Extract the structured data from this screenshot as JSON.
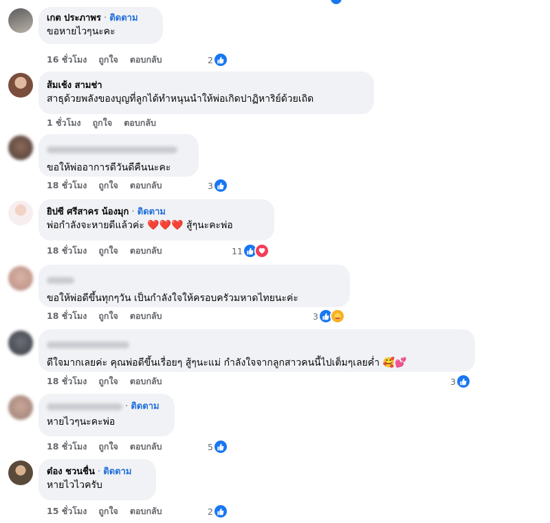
{
  "comments": [
    {
      "name": "เกต ประภาพร",
      "follow": "ติดตาม",
      "text": "ขอหายไวๆนะคะ",
      "time": "16 ชั่วโมง",
      "like": "ถูกใจ",
      "reply": "ตอบกลับ",
      "reaction_count": "2",
      "reactions": [
        "like"
      ]
    },
    {
      "name": "ส้มเช้ง สามช่า",
      "text": "สาธุด้วยพลังของบุญที่ลูกได้ทำหนุนนำให้พ่อเกิดปาฏิหาริย์ด้วยเถิด",
      "time": "1 ชั่วโมง",
      "like": "ถูกใจ",
      "reply": "ตอบกลับ"
    },
    {
      "name_blurred": true,
      "text": "ขอให้พ่ออาการดีวันดีคืนนะคะ",
      "time": "18 ชั่วโมง",
      "like": "ถูกใจ",
      "reply": "ตอบกลับ",
      "reaction_count": "3",
      "reactions": [
        "like"
      ]
    },
    {
      "name": "ยิปซี ศรีสาคร น้องมุก",
      "follow": "ติดตาม",
      "text": "พ่อกำลังจะหายดีแล้วค่ะ ❤️❤️❤️ สู้ๆนะคะพ่อ",
      "time": "18 ชั่วโมง",
      "like": "ถูกใจ",
      "reply": "ตอบกลับ",
      "reaction_count": "11",
      "reactions": [
        "like",
        "love"
      ]
    },
    {
      "name_blurred": true,
      "text": "ขอให้พ่อดีขึ้นทุกๆวัน เป็นกำลังใจให้ครอบครัวมหาดไทยนะค่ะ",
      "time": "18 ชั่วโมง",
      "like": "ถูกใจ",
      "reply": "ตอบกลับ",
      "reaction_count": "3",
      "reactions": [
        "like",
        "care"
      ]
    },
    {
      "name_blurred": true,
      "text": "ดีใจมากเลยค่ะ คุณพ่อดีขึ้นเรื่อยๆ สู้ๆนะแม่ กำลังใจจากลูกสาวคนนี้ไปเต็มๆเลยค่ำ 🥰💕",
      "time": "18 ชั่วโมง",
      "like": "ถูกใจ",
      "reply": "ตอบกลับ",
      "reaction_count": "3",
      "reactions": [
        "like"
      ]
    },
    {
      "name_blurred": true,
      "follow": "ติดตาม",
      "text": "หายไวๆนะคะพ่อ",
      "time": "18 ชั่วโมง",
      "like": "ถูกใจ",
      "reply": "ตอบกลับ",
      "reaction_count": "5",
      "reactions": [
        "like"
      ]
    },
    {
      "name": "ต๋อง ชวนชื่น",
      "follow": "ติดตาม",
      "text": "หายไวไวครับ",
      "time": "15 ชั่วโมง",
      "like": "ถูกใจ",
      "reply": "ตอบกลับ",
      "reaction_count": "2",
      "reactions": [
        "like"
      ]
    }
  ],
  "colors": {
    "bubble": "#f0f2f5",
    "follow": "#216fdb",
    "meta": "#65676b",
    "like": "#1877f2",
    "love": "#f33e58"
  }
}
